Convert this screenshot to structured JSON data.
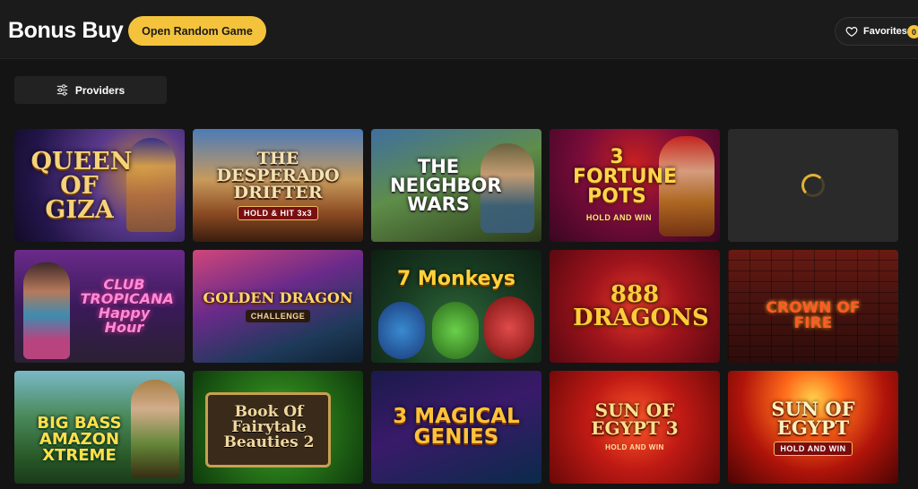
{
  "header": {
    "title": "Bonus Buy",
    "random_game_label": "Open Random Game",
    "favorites_label": "Favorites",
    "favorites_count": "0"
  },
  "filters": {
    "providers_label": "Providers"
  },
  "games": [
    {
      "title": "QUEEN OF GIZA",
      "subtitle": ""
    },
    {
      "title": "THE DESPERADO DRIFTER",
      "subtitle": "HOLD & HIT 3x3"
    },
    {
      "title": "THE NEIGHBOR WARS",
      "subtitle": ""
    },
    {
      "title": "3 FORTUNE POTS",
      "subtitle": "HOLD AND WIN"
    },
    {
      "title": "",
      "subtitle": "",
      "loading": true
    },
    {
      "title": "CLUB TROPICANA Happy Hour",
      "subtitle": ""
    },
    {
      "title": "GOLDEN DRAGON",
      "subtitle": "CHALLENGE"
    },
    {
      "title": "7 Monkeys",
      "subtitle": ""
    },
    {
      "title": "888 DRAGONS",
      "subtitle": ""
    },
    {
      "title": "CROWN OF FIRE",
      "subtitle": ""
    },
    {
      "title": "BIG BASS AMAZON XTREME",
      "subtitle": ""
    },
    {
      "title": "Book Of Fairytale Beauties 2",
      "subtitle": ""
    },
    {
      "title": "3 MAGICAL GENIES",
      "subtitle": ""
    },
    {
      "title": "SUN OF EGYPT 3",
      "subtitle": "HOLD AND WIN"
    },
    {
      "title": "SUN OF EGYPT",
      "subtitle": "HOLD AND WIN"
    }
  ]
}
